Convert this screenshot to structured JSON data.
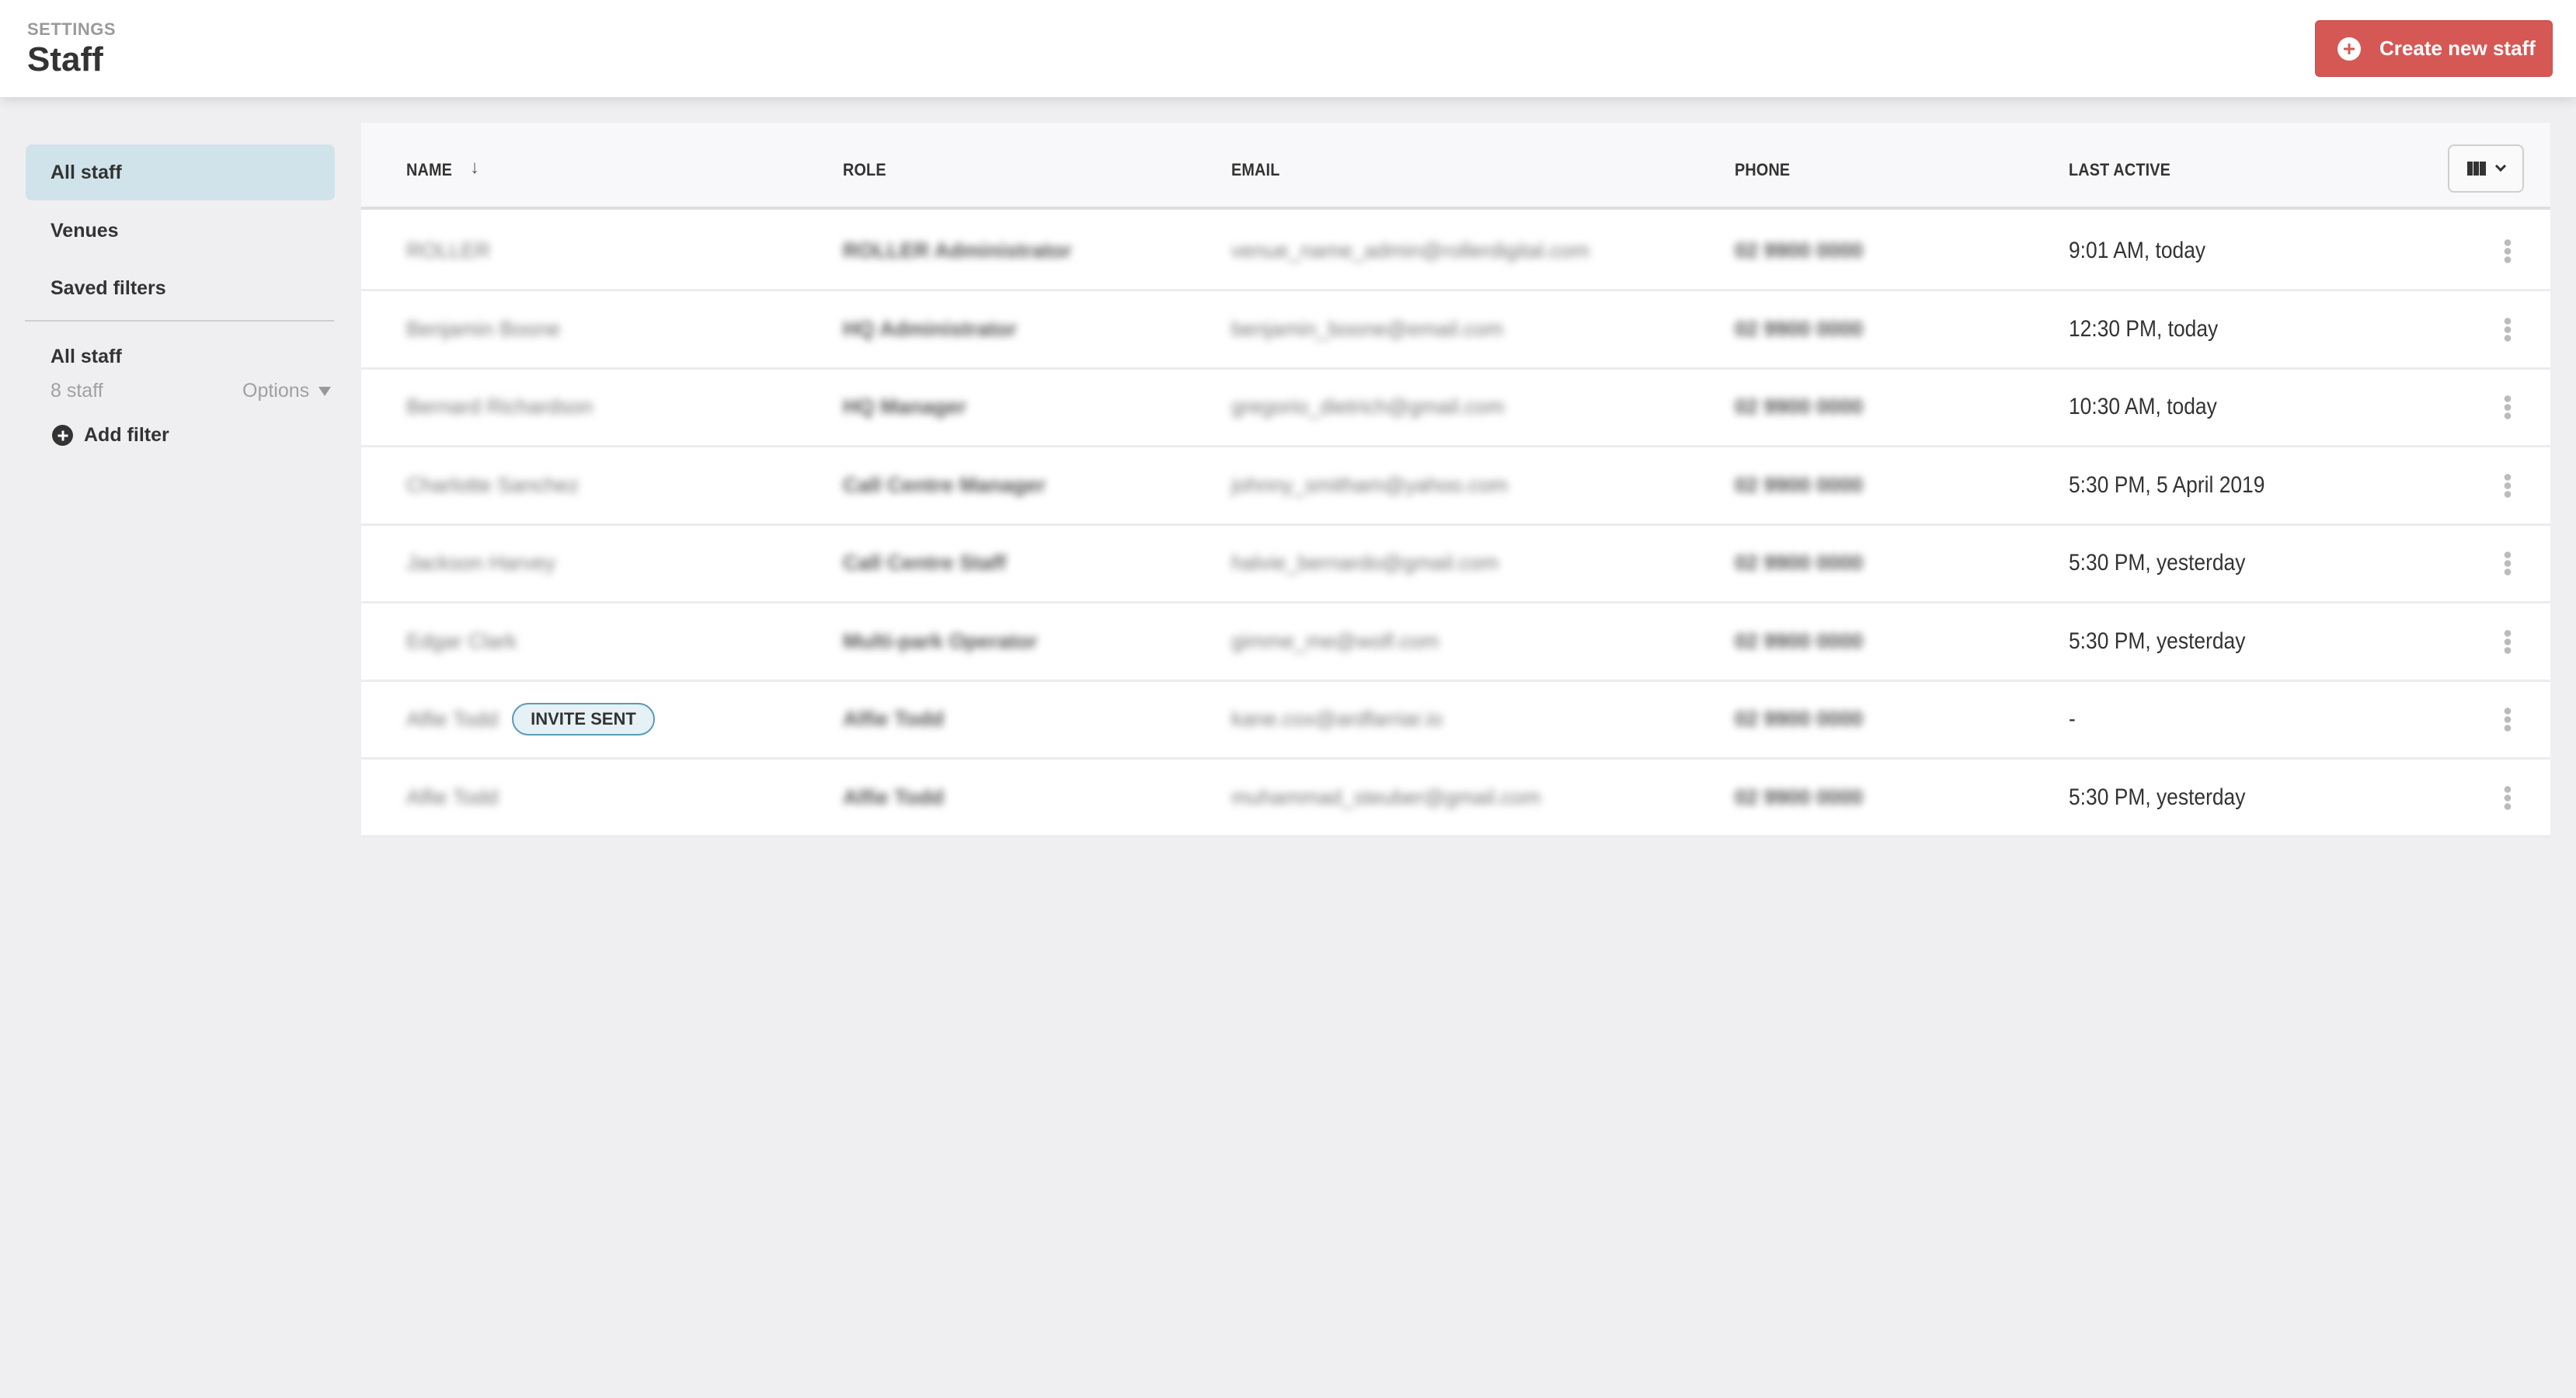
{
  "header": {
    "eyebrow": "SETTINGS",
    "title": "Staff",
    "create_button": "Create new staff",
    "accent_color": "#d65855"
  },
  "sidebar": {
    "nav": [
      {
        "label": "All staff",
        "active": true
      },
      {
        "label": "Venues",
        "active": false
      },
      {
        "label": "Saved filters",
        "active": false
      }
    ],
    "filter_title": "All staff",
    "staff_count": "8 staff",
    "options_label": "Options",
    "add_filter_label": "Add filter"
  },
  "table": {
    "columns": {
      "name": "NAME",
      "role": "ROLE",
      "email": "EMAIL",
      "phone": "PHONE",
      "last_active": "LAST ACTIVE"
    },
    "sort": {
      "column": "name",
      "direction": "descending-arrow"
    },
    "column_picker_icon": "columns-icon",
    "rows": [
      {
        "name": "ROLLER",
        "role": "ROLLER Administrator",
        "email": "venue_name_admin@rollerdigital.com",
        "phone": "02 9900 0000",
        "last_active": "9:01 AM, today",
        "badge": ""
      },
      {
        "name": "Benjamin Boone",
        "role": "HQ Administrator",
        "email": "benjamin_boone@email.com",
        "phone": "02 9900 0000",
        "last_active": "12:30 PM, today",
        "badge": ""
      },
      {
        "name": "Bernard Richardson",
        "role": "HQ Manager",
        "email": "gregorio_dietrich@gmail.com",
        "phone": "02 9900 0000",
        "last_active": "10:30 AM, today",
        "badge": ""
      },
      {
        "name": "Charlotte Sanchez",
        "role": "Call Centre Manager",
        "email": "johnny_smitham@yahoo.com",
        "phone": "02 9900 0000",
        "last_active": "5:30 PM, 5 April 2019",
        "badge": ""
      },
      {
        "name": "Jackson Harvey",
        "role": "Call Centre Staff",
        "email": "halvie_bernardo@gmail.com",
        "phone": "02 9900 0000",
        "last_active": "5:30 PM, yesterday",
        "badge": ""
      },
      {
        "name": "Edgar Clark",
        "role": "Multi-park Operator",
        "email": "gimme_me@wolf.com",
        "phone": "02 9900 0000",
        "last_active": "5:30 PM, yesterday",
        "badge": ""
      },
      {
        "name": "Alfie Todd",
        "role": "Alfie Todd",
        "email": "kane.cox@ardfarriar.io",
        "phone": "02 9900 0000",
        "last_active": "-",
        "badge": "INVITE SENT"
      },
      {
        "name": "Alfie Todd",
        "role": "Alfie Todd",
        "email": "muhammad_steuber@gmail.com",
        "phone": "02 9900 0000",
        "last_active": "5:30 PM, yesterday",
        "badge": ""
      }
    ]
  }
}
